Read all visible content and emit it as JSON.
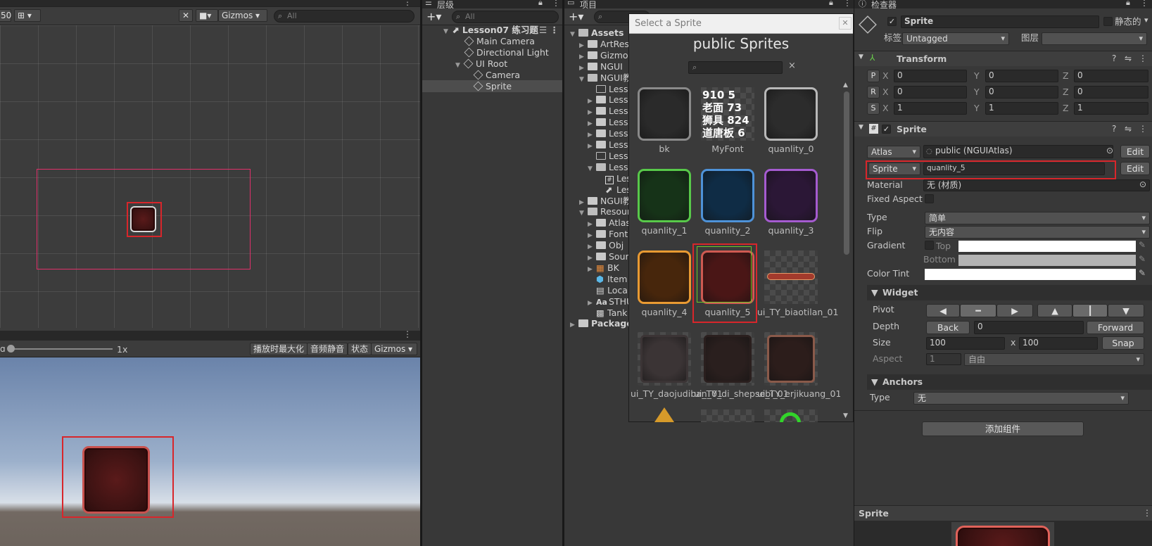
{
  "scene": {
    "toolbar": {
      "zoom_stub": "50",
      "layout_glyph": "⊞",
      "gizmos": "Gizmos",
      "search_placeholder": "All"
    },
    "game_toolbar": {
      "scale_label": "1x",
      "maximize": "播放时最大化",
      "mute": "音频静音",
      "stats": "状态",
      "gizmos": "Gizmos",
      "more": "⋮"
    }
  },
  "hierarchy": {
    "tab": "层级",
    "search_placeholder": "All",
    "items": [
      {
        "label": "Lesson07 练习题",
        "kind": "scene"
      },
      {
        "label": "Main Camera",
        "kind": "go"
      },
      {
        "label": "Directional Light",
        "kind": "go"
      },
      {
        "label": "UI Root",
        "kind": "go"
      },
      {
        "label": "Camera",
        "kind": "go"
      },
      {
        "label": "Sprite",
        "kind": "go"
      }
    ]
  },
  "project": {
    "tab": "项目",
    "items": [
      {
        "label": "Assets"
      },
      {
        "label": "ArtRes"
      },
      {
        "label": "Gizmos"
      },
      {
        "label": "NGUI"
      },
      {
        "label": "NGUI教"
      },
      {
        "label": "Lesso"
      },
      {
        "label": "Lesso"
      },
      {
        "label": "Lesso"
      },
      {
        "label": "Lesso"
      },
      {
        "label": "Lesso"
      },
      {
        "label": "Lesso"
      },
      {
        "label": "Lesso"
      },
      {
        "label": "Lesso"
      },
      {
        "label": "Les"
      },
      {
        "label": "Les"
      },
      {
        "label": "NGUI教"
      },
      {
        "label": "Resour"
      },
      {
        "label": "Atlas"
      },
      {
        "label": "Font"
      },
      {
        "label": "Obj"
      },
      {
        "label": "Soun"
      },
      {
        "label": "BK"
      },
      {
        "label": "Item"
      },
      {
        "label": "Local"
      },
      {
        "label": "STHU"
      },
      {
        "label": "Tank"
      },
      {
        "label": "Packages"
      }
    ]
  },
  "picker": {
    "window_title": "Select a Sprite",
    "atlas_title": "public Sprites",
    "clear": "×",
    "sprites": [
      {
        "name": "bk",
        "color": "#2a2a2a",
        "border": "#8a8a8a"
      },
      {
        "name": "MyFont",
        "color": "",
        "border": ""
      },
      {
        "name": "quanlity_0",
        "color": "#2c2c2c",
        "border": "#b8b8b8"
      },
      {
        "name": "quanlity_1",
        "color": "#163318",
        "border": "#58c94a"
      },
      {
        "name": "quanlity_2",
        "color": "#0f2c45",
        "border": "#4e92d8"
      },
      {
        "name": "quanlity_3",
        "color": "#2b1736",
        "border": "#a55bd0"
      },
      {
        "name": "quanlity_4",
        "color": "#47260c",
        "border": "#e99a32"
      },
      {
        "name": "quanlity_5",
        "color": "#4a1616",
        "border": "#cf5a52"
      },
      {
        "name": "ui_TY_biaotilan_01",
        "color": "",
        "border": ""
      },
      {
        "name": "ui_TY_daojudiban_01",
        "color": "#3b3435",
        "border": "#3b3435"
      },
      {
        "name": "ui_TY_di_shepsebi_01",
        "color": "#2a1f1e",
        "border": "#2a1f1e"
      },
      {
        "name": "ui_TY_erjikuang_01",
        "color": "#2c1d1b",
        "border": "#8a5a4a"
      }
    ],
    "myfont_glyphs": "910 5\n老面 73\n狮具 824\n道唐板 6"
  },
  "inspector": {
    "tab": "检查器",
    "object_name": "Sprite",
    "static_label": "静态的",
    "tag_label": "标签",
    "tag_value": "Untagged",
    "layer_label": "图层",
    "layer_value": "",
    "transform": {
      "title": "Transform",
      "rows": [
        {
          "key": "P",
          "x": "0",
          "y": "0",
          "z": "0"
        },
        {
          "key": "R",
          "x": "0",
          "y": "0",
          "z": "0"
        },
        {
          "key": "S",
          "x": "1",
          "y": "1",
          "z": "1"
        }
      ],
      "axis_x": "X",
      "axis_y": "Y",
      "axis_z": "Z"
    },
    "sprite": {
      "title": "Sprite",
      "atlas_dd": "Atlas",
      "atlas_value": "public (NGUIAtlas)",
      "edit": "Edit",
      "sprite_dd": "Sprite",
      "sprite_value": "quanlity_5",
      "material_label": "Material",
      "material_value": "无 (材质)",
      "fixed_aspect_label": "Fixed Aspect",
      "type_label": "Type",
      "type_value": "简单",
      "flip_label": "Flip",
      "flip_value": "无内容",
      "gradient_label": "Gradient",
      "gradient_top": "Top",
      "gradient_bottom": "Bottom",
      "color_tint_label": "Color Tint"
    },
    "widget": {
      "title": "Widget",
      "pivot_label": "Pivot",
      "depth_label": "Depth",
      "back": "Back",
      "depth_value": "0",
      "forward": "Forward",
      "size_label": "Size",
      "width": "100",
      "times": "x",
      "height": "100",
      "snap": "Snap",
      "aspect_label": "Aspect",
      "aspect_value": "1",
      "aspect_mode": "自由"
    },
    "anchors": {
      "title": "Anchors",
      "type_label": "Type",
      "type_value": "无"
    },
    "add_component": "添加组件",
    "preview_title": "Sprite"
  },
  "colors": {
    "highlight": "#d8262b",
    "selected_green": "#6ecb2b"
  }
}
